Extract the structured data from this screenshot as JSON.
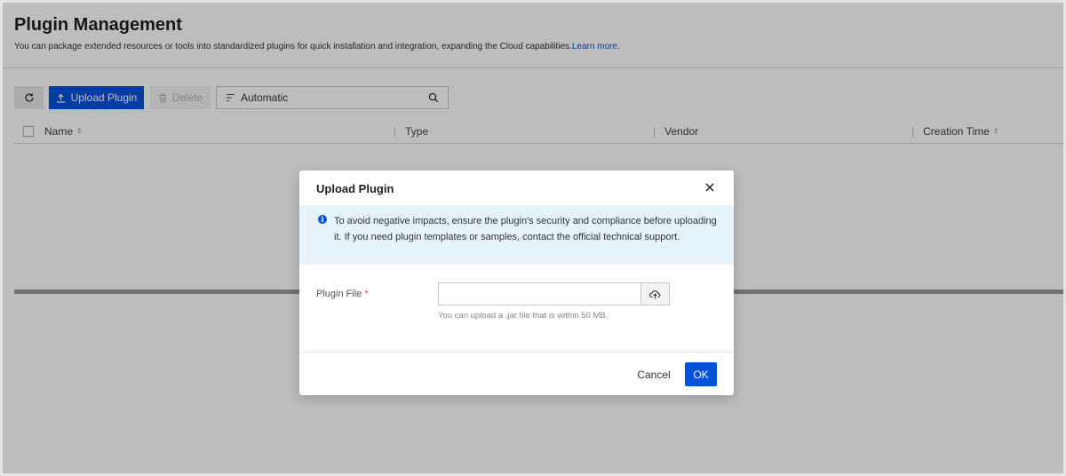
{
  "page": {
    "title": "Plugin Management",
    "description": "You can package extended resources or tools into standardized plugins for quick installation and integration, expanding the Cloud capabilities.",
    "learn_more": "Learn more."
  },
  "toolbar": {
    "refresh_icon": "refresh-icon",
    "upload_label": "Upload Plugin",
    "delete_label": "Delete",
    "filter_value": "Automatic"
  },
  "table": {
    "columns": [
      "Name",
      "Type",
      "Vendor",
      "Creation Time"
    ]
  },
  "modal": {
    "title": "Upload Plugin",
    "notice": "To avoid negative impacts, ensure the plugin's security and compliance before uploading it. If you need plugin templates or samples, contact the official technical support.",
    "field_label": "Plugin File",
    "required_mark": "*",
    "file_value": "",
    "hint": "You can upload a .jar file that is within 50 MB.",
    "cancel_label": "Cancel",
    "ok_label": "OK"
  },
  "colors": {
    "primary": "#0052d9",
    "notice_bg": "#e5f3fb",
    "required": "#e34d59"
  }
}
